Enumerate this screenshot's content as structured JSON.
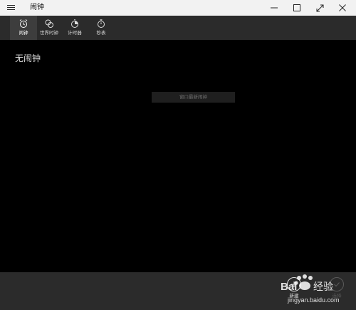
{
  "titlebar": {
    "title": "闹钟",
    "controls": [
      "minimize",
      "maximize",
      "fullscreen",
      "close"
    ]
  },
  "nav": {
    "tabs": [
      {
        "id": "alarm",
        "label": "闹钟",
        "icon": "alarm-clock-icon",
        "active": true
      },
      {
        "id": "world",
        "label": "世界时钟",
        "icon": "world-clock-icon",
        "active": false
      },
      {
        "id": "timer",
        "label": "计时器",
        "icon": "timer-icon",
        "active": false
      },
      {
        "id": "stopwatch",
        "label": "秒表",
        "icon": "stopwatch-icon",
        "active": false
      }
    ]
  },
  "main": {
    "empty_label": "无闹钟",
    "hint": "窗口最新闹钟"
  },
  "commandbar": {
    "new_label": "新建",
    "select_label": "选择"
  },
  "watermark": {
    "brand": "Bai",
    "text": "经验",
    "url": "jingyan.baidu.com"
  },
  "colors": {
    "background": "#000000",
    "titlebar": "#f2f2f2",
    "navbar": "#2b2b2b",
    "active_tab": "#3d3d3d",
    "hint_box": "#1f1f1f"
  }
}
